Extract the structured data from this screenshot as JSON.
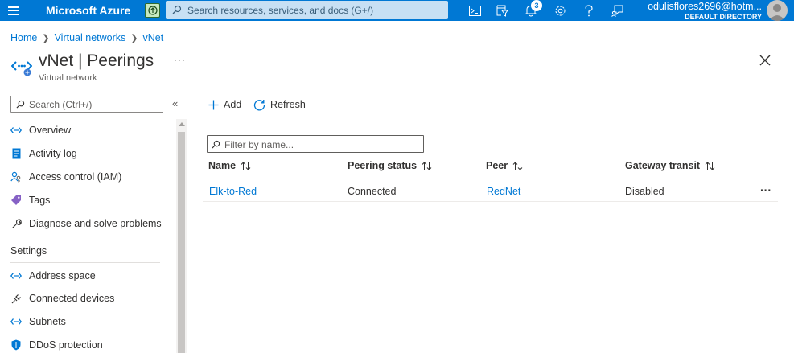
{
  "topbar": {
    "brand": "Microsoft Azure",
    "search_placeholder": "Search resources, services, and docs (G+/)",
    "notifications_count": "3",
    "user_email": "odulisflores2696@hotm...",
    "user_directory": "DEFAULT DIRECTORY",
    "accent_color": "#0078d4"
  },
  "breadcrumb": {
    "items": [
      "Home",
      "Virtual networks",
      "vNet"
    ]
  },
  "header": {
    "title": "vNet | Peerings",
    "subtitle": "Virtual network",
    "more": "···"
  },
  "nav": {
    "search_placeholder": "Search (Ctrl+/)",
    "collapse": "«",
    "items": [
      {
        "label": "Overview",
        "icon": "vnet-icon"
      },
      {
        "label": "Activity log",
        "icon": "activity-log-icon"
      },
      {
        "label": "Access control (IAM)",
        "icon": "iam-icon"
      },
      {
        "label": "Tags",
        "icon": "tag-icon"
      },
      {
        "label": "Diagnose and solve problems",
        "icon": "wrench-icon"
      }
    ],
    "section_settings": "Settings",
    "settings_items": [
      {
        "label": "Address space",
        "icon": "vnet-icon"
      },
      {
        "label": "Connected devices",
        "icon": "plug-icon"
      },
      {
        "label": "Subnets",
        "icon": "vnet-icon"
      },
      {
        "label": "DDoS protection",
        "icon": "shield-icon"
      }
    ]
  },
  "commands": {
    "add": "Add",
    "refresh": "Refresh"
  },
  "filter": {
    "placeholder": "Filter by name..."
  },
  "table": {
    "columns": [
      "Name",
      "Peering status",
      "Peer",
      "Gateway transit"
    ],
    "rows": [
      {
        "name": "Elk-to-Red",
        "status": "Connected",
        "peer": "RedNet",
        "gateway_transit": "Disabled",
        "more": "···"
      }
    ]
  }
}
